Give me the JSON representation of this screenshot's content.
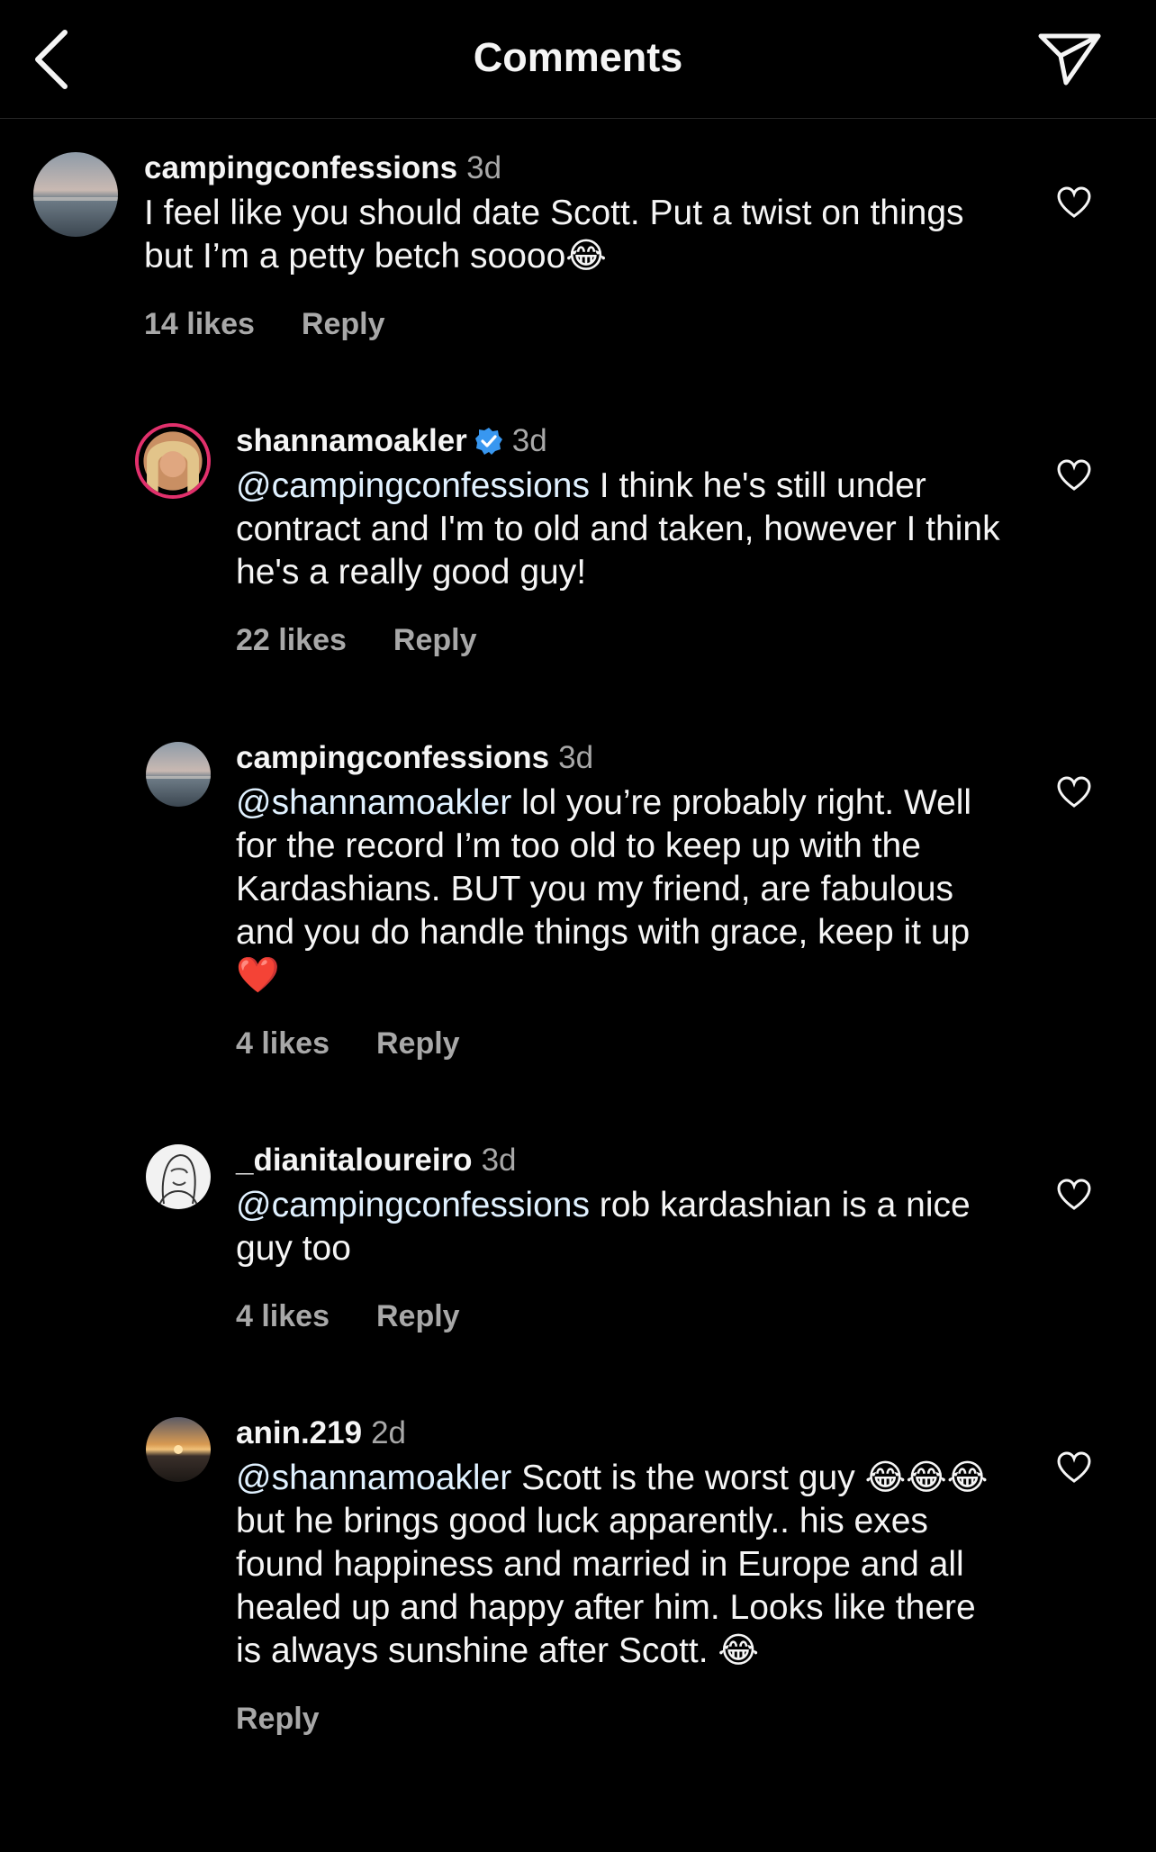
{
  "header": {
    "title": "Comments"
  },
  "comments": [
    {
      "username": "campingconfessions",
      "time": "3d",
      "verified": false,
      "mention": "",
      "text": "I feel like you should date Scott. Put a twist on things but I’m a petty betch soooo",
      "emoji_tail": "😂",
      "likes": "14 likes",
      "reply": "Reply"
    },
    {
      "username": "shannamoakler",
      "time": "3d",
      "verified": true,
      "mention": "@campingconfessions",
      "text": " I think he's still under contract and I'm to old and taken, however I think he's a really good guy!",
      "emoji_tail": "",
      "likes": "22 likes",
      "reply": "Reply"
    },
    {
      "username": "campingconfessions",
      "time": "3d",
      "verified": false,
      "mention": "@shannamoakler",
      "text": " lol you’re probably right. Well for the record I’m too old to keep up with the Kardashians. BUT you my friend, are fabulous and you do handle things with grace, keep it up ",
      "emoji_tail": "❤️",
      "likes": "4 likes",
      "reply": "Reply"
    },
    {
      "username": "_dianitaloureiro",
      "time": "3d",
      "verified": false,
      "mention": "@campingconfessions",
      "text": " rob kardashian is a nice guy too",
      "emoji_tail": "",
      "likes": "4 likes",
      "reply": "Reply"
    },
    {
      "username": "anin.219",
      "time": "2d",
      "verified": false,
      "mention": "@shannamoakler",
      "text": " Scott is the worst guy 😂😂😂 but he brings good luck apparently.. his exes found happiness and married in Europe and all healed up and happy after him. Looks like there is always sunshine after Scott. ",
      "emoji_tail": "😂",
      "likes": "",
      "reply": "Reply"
    }
  ],
  "colors": {
    "background": "#000000",
    "text": "#f5f5f5",
    "secondary": "#a8a8a8",
    "mention": "#e0f1ff",
    "verified": "#3897f0"
  }
}
